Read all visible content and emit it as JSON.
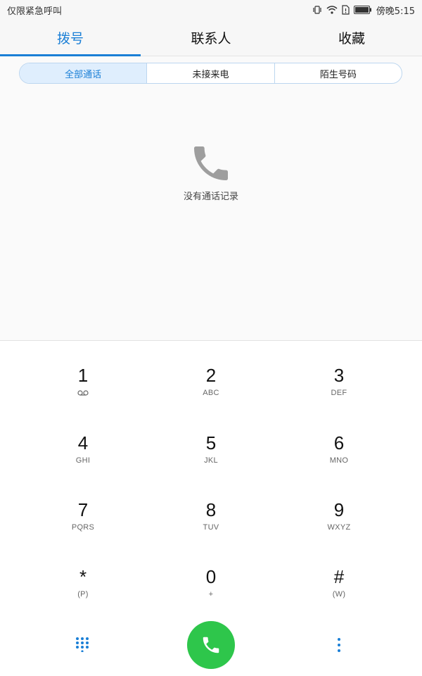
{
  "status_bar": {
    "left_text": "仅限紧急呼叫",
    "time": "傍晚5:15",
    "icons": [
      "vibrate-icon",
      "wifi-icon",
      "sim-icon",
      "battery-icon"
    ]
  },
  "tabs": [
    {
      "label": "拨号",
      "active": true
    },
    {
      "label": "联系人",
      "active": false
    },
    {
      "label": "收藏",
      "active": false
    }
  ],
  "filters": [
    {
      "label": "全部通话",
      "active": true
    },
    {
      "label": "未接来电",
      "active": false
    },
    {
      "label": "陌生号码",
      "active": false
    }
  ],
  "empty_state": {
    "icon": "phone-icon",
    "text": "没有通话记录"
  },
  "dialpad": {
    "keys": [
      {
        "digit": "1",
        "sub": "",
        "sub_icon": "voicemail-icon"
      },
      {
        "digit": "2",
        "sub": "ABC"
      },
      {
        "digit": "3",
        "sub": "DEF"
      },
      {
        "digit": "4",
        "sub": "GHI"
      },
      {
        "digit": "5",
        "sub": "JKL"
      },
      {
        "digit": "6",
        "sub": "MNO"
      },
      {
        "digit": "7",
        "sub": "PQRS"
      },
      {
        "digit": "8",
        "sub": "TUV"
      },
      {
        "digit": "9",
        "sub": "WXYZ"
      },
      {
        "digit": "*",
        "sub": "(P)"
      },
      {
        "digit": "0",
        "sub": "+"
      },
      {
        "digit": "#",
        "sub": "(W)"
      }
    ],
    "bottom": {
      "left_icon": "dialpad-grid-icon",
      "call_icon": "call-icon",
      "right_icon": "more-vertical-icon"
    }
  },
  "colors": {
    "accent": "#1a7fd6",
    "call_green": "#2ec64b",
    "filter_active_bg": "#dfeefd"
  }
}
